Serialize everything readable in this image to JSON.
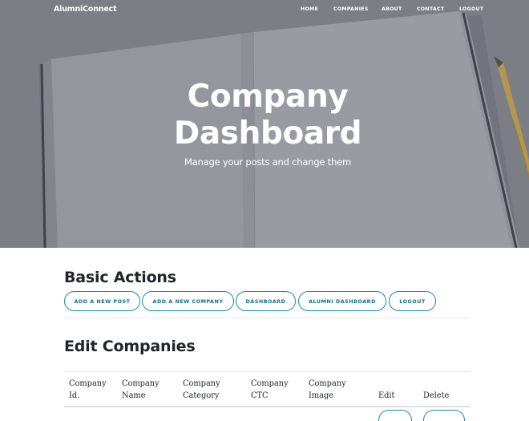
{
  "navbar": {
    "brand": "AlumniConnect",
    "links": [
      "HOME",
      "COMPANIES",
      "ABOUT",
      "CONTACT",
      "LOGOUT"
    ]
  },
  "hero": {
    "title_line1": "Company",
    "title_line2": "Dashboard",
    "subtitle": "Manage your posts and change them"
  },
  "basic_actions": {
    "heading": "Basic Actions",
    "buttons": [
      "ADD A NEW POST",
      "ADD A NEW COMPANY",
      "DASHBOARD",
      "ALUMNI DASHBOARD",
      "LOGOUT"
    ]
  },
  "edit_companies": {
    "heading": "Edit Companies",
    "columns": [
      {
        "line1": "Company",
        "line2": "Id."
      },
      {
        "line1": "Company",
        "line2": "Name"
      },
      {
        "line1": "Company",
        "line2": "Category"
      },
      {
        "line1": "Company",
        "line2": "CTC"
      },
      {
        "line1": "Company",
        "line2": "Image"
      },
      {
        "line1": "",
        "line2": "Edit"
      },
      {
        "line1": "",
        "line2": "Delete"
      }
    ]
  },
  "colors": {
    "accent": "#1c8ba0",
    "hero_overlay": "#8a8b91"
  },
  "icons": {
    "hero_background": "notebook-and-pencil-image"
  }
}
